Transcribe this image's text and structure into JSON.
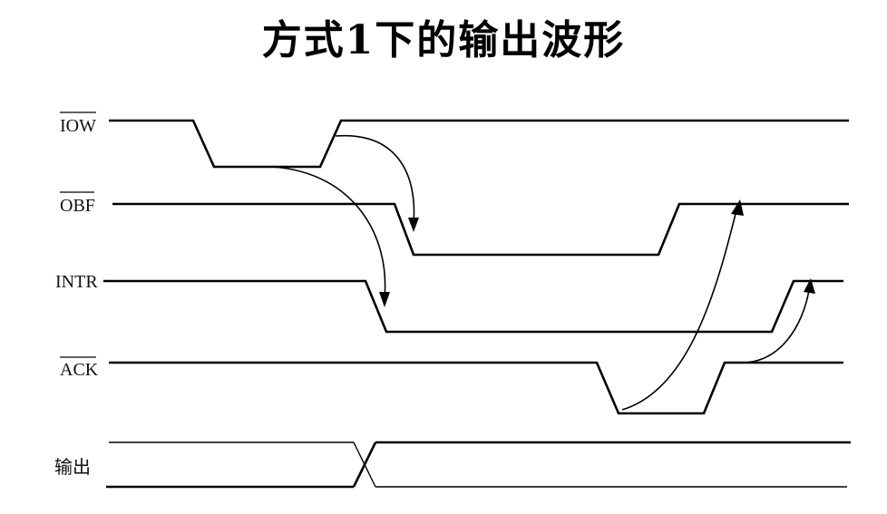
{
  "title": "方式1下的输出波形",
  "signals": [
    {
      "id": "iow",
      "label": "IOW",
      "overline": true
    },
    {
      "id": "obf",
      "label": "OBF",
      "overline": true
    },
    {
      "id": "intr",
      "label": "INTR",
      "overline": false
    },
    {
      "id": "ack",
      "label": "ACK",
      "overline": true
    },
    {
      "id": "out",
      "label": "输出",
      "overline": false
    }
  ]
}
